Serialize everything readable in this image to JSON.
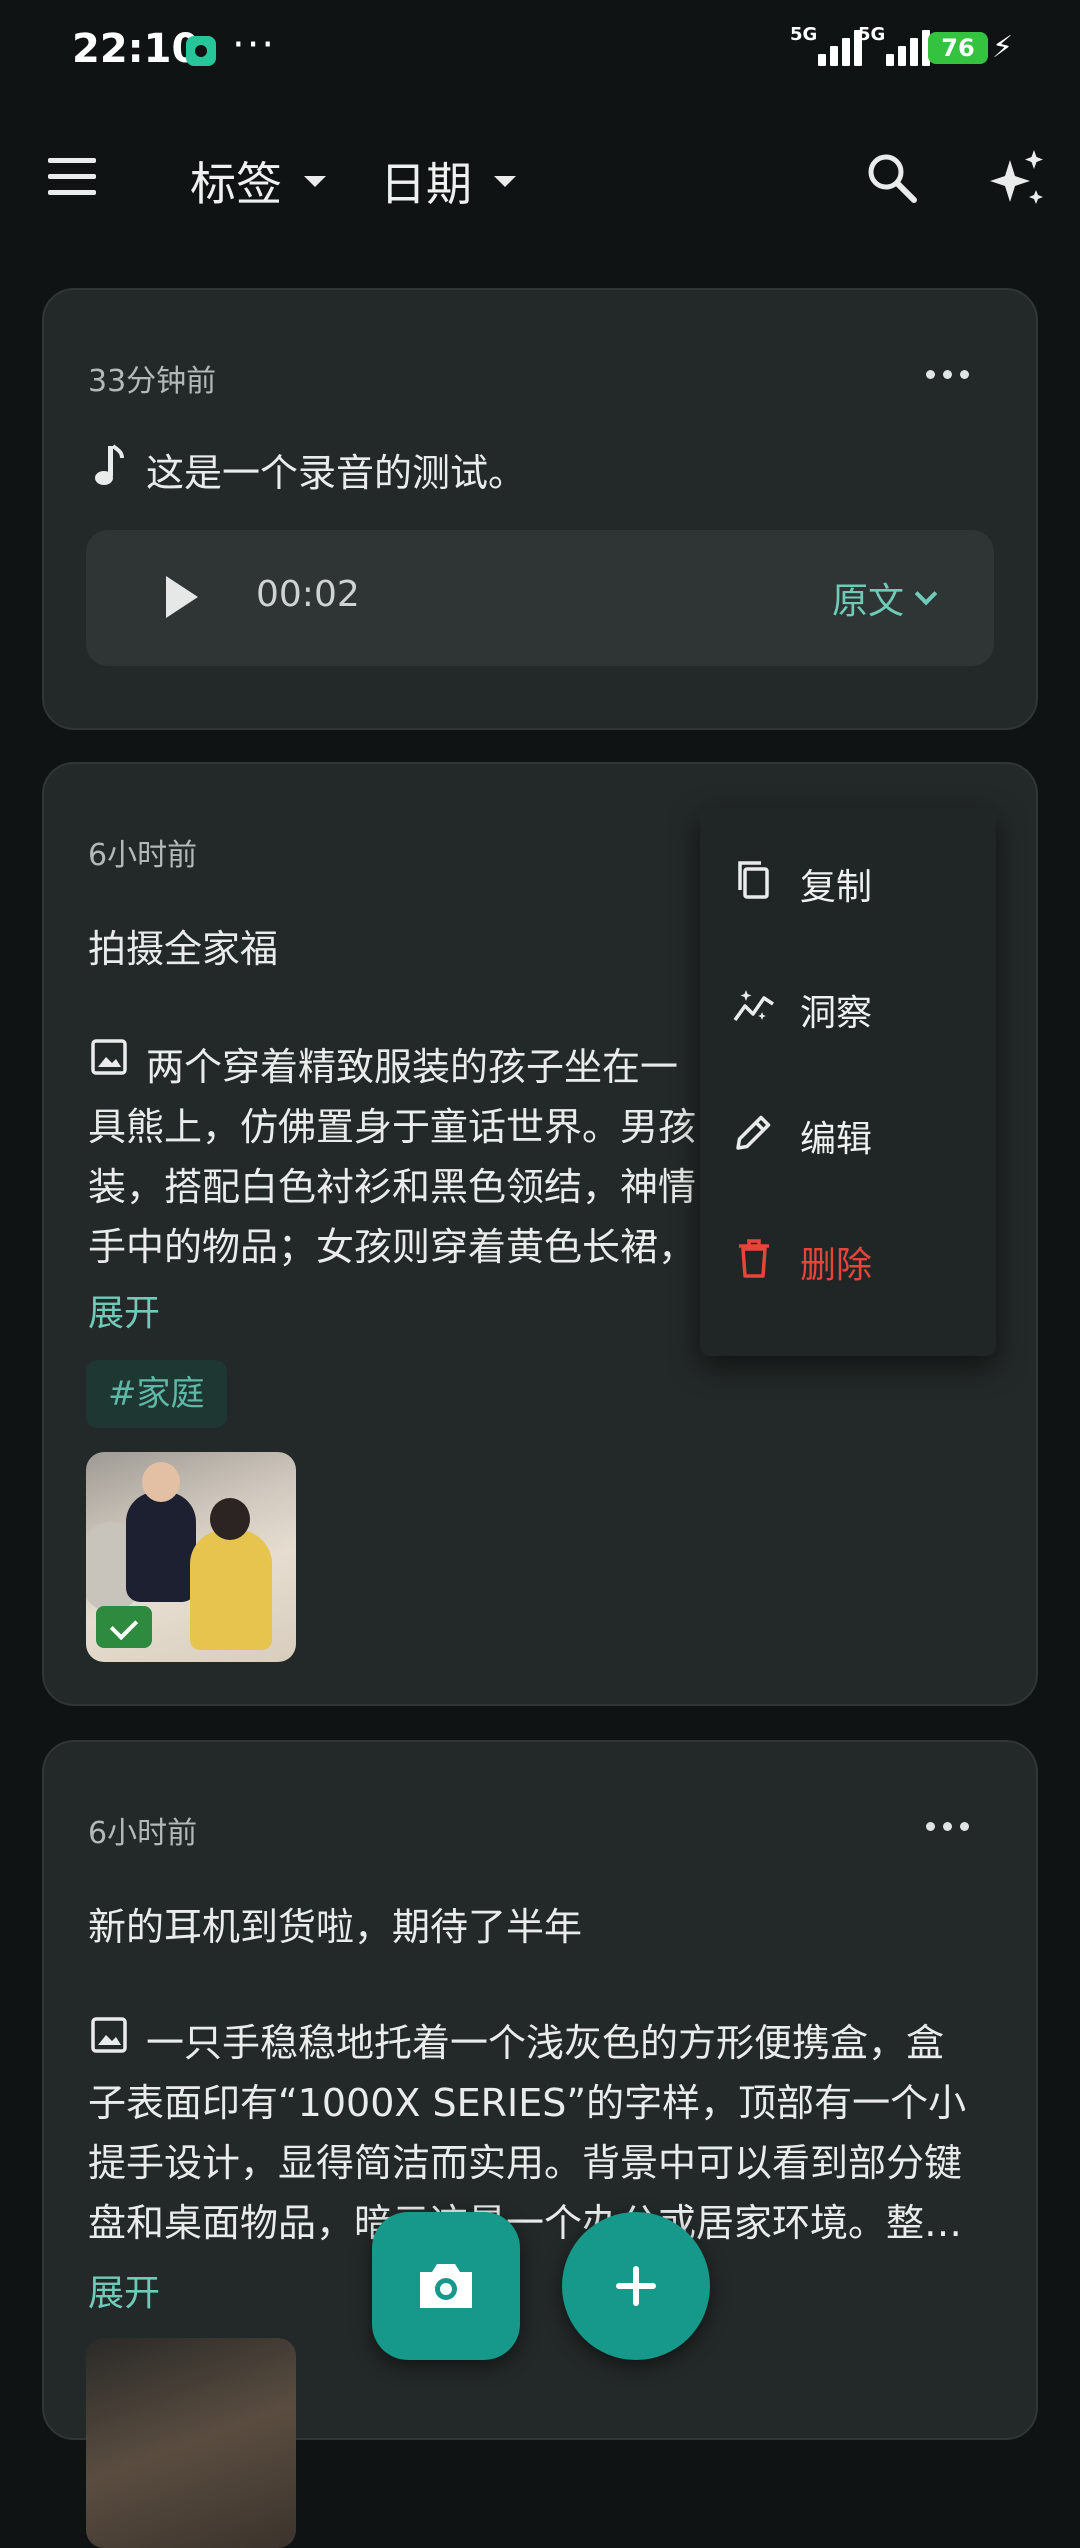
{
  "status_bar": {
    "time": "22:10",
    "dots": "···",
    "network_1": "5G",
    "network_2": "5G",
    "battery": "76",
    "battery_color": "#33c33f"
  },
  "toolbar": {
    "tags_label": "标签",
    "date_label": "日期",
    "icons": [
      "menu-icon",
      "search-icon",
      "sparkle-icon"
    ]
  },
  "cards": [
    {
      "time": "33分钟前",
      "text": "这是一个录音的测试。",
      "audio": {
        "duration": "00:02",
        "original_label": "原文"
      }
    },
    {
      "time": "6小时前",
      "title": "拍摄全家福",
      "desc_lines": [
        "两个穿着精致服装的孩子坐在一",
        "具熊上，仿佛置身于童话世界。男孩",
        "装，搭配白色衬衫和黑色领结，神情",
        "手中的物品；女孩则穿着黄色长裙，"
      ],
      "expand_label": "展开",
      "tag": "#家庭"
    },
    {
      "time": "6小时前",
      "title": "新的耳机到货啦，期待了半年",
      "desc_lines": [
        "一只手稳稳地托着一个浅灰色的方形便携盒，盒",
        "子表面印有“1000X SERIES”的字样，顶部有一个小",
        "提手设计，显得简洁而实用。背景中可以看到部分键",
        "盘和桌面物品，暗示这是一个办公或居家环境。整…"
      ],
      "expand_label": "展开"
    }
  ],
  "popup_menu": {
    "items": [
      {
        "label": "复制",
        "icon": "copy-icon"
      },
      {
        "label": "洞察",
        "icon": "insight-icon"
      },
      {
        "label": "编辑",
        "icon": "edit-icon"
      },
      {
        "label": "删除",
        "icon": "delete-icon"
      }
    ],
    "danger_color": "#e5453a"
  },
  "fabs": {
    "camera_icon": "camera-icon",
    "add_icon": "plus-icon",
    "color": "#16988a"
  },
  "accent_color": "#6fcbb8"
}
